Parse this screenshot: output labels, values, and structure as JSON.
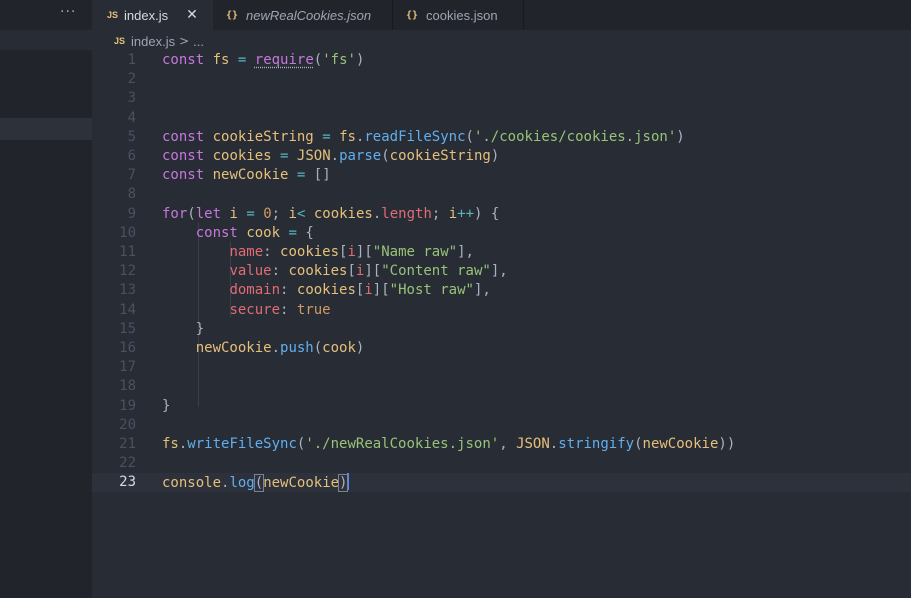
{
  "sidebar": {
    "more_label": "···"
  },
  "tabs": [
    {
      "label": "index.js",
      "icon": "JS",
      "close": "✕"
    },
    {
      "label": "newRealCookies.json",
      "icon": "{}"
    },
    {
      "label": "cookies.json",
      "icon": "{}"
    }
  ],
  "breadcrumb": {
    "icon": "JS",
    "file": "index.js",
    "separator": ">",
    "more": "..."
  },
  "editor": {
    "current_line": 23,
    "line_numbers": [
      "1",
      "2",
      "3",
      "4",
      "5",
      "6",
      "7",
      "8",
      "9",
      "10",
      "11",
      "12",
      "13",
      "14",
      "15",
      "16",
      "17",
      "18",
      "19",
      "20",
      "21",
      "22",
      "23"
    ],
    "lines": [
      "const fs = require('fs')",
      "",
      "",
      "",
      "const cookieString = fs.readFileSync('./cookies/cookies.json')",
      "const cookies = JSON.parse(cookieString)",
      "const newCookie = []",
      "",
      "for(let i = 0; i< cookies.length; i++) {",
      "    const cook = {",
      "        name: cookies[i][\"Name raw\"],",
      "        value: cookies[i][\"Content raw\"],",
      "        domain: cookies[i][\"Host raw\"],",
      "        secure: true",
      "    }",
      "    newCookie.push(cook)",
      "",
      "",
      "}",
      "",
      "fs.writeFileSync('./newRealCookies.json', JSON.stringify(newCookie))",
      "",
      "console.log(newCookie)"
    ]
  },
  "colors": {
    "background": "#282c34",
    "keyword": "#c678dd",
    "variable": "#e5c07b",
    "function": "#61afef",
    "string": "#98c379",
    "property": "#e06c75",
    "constant": "#d19a66"
  }
}
